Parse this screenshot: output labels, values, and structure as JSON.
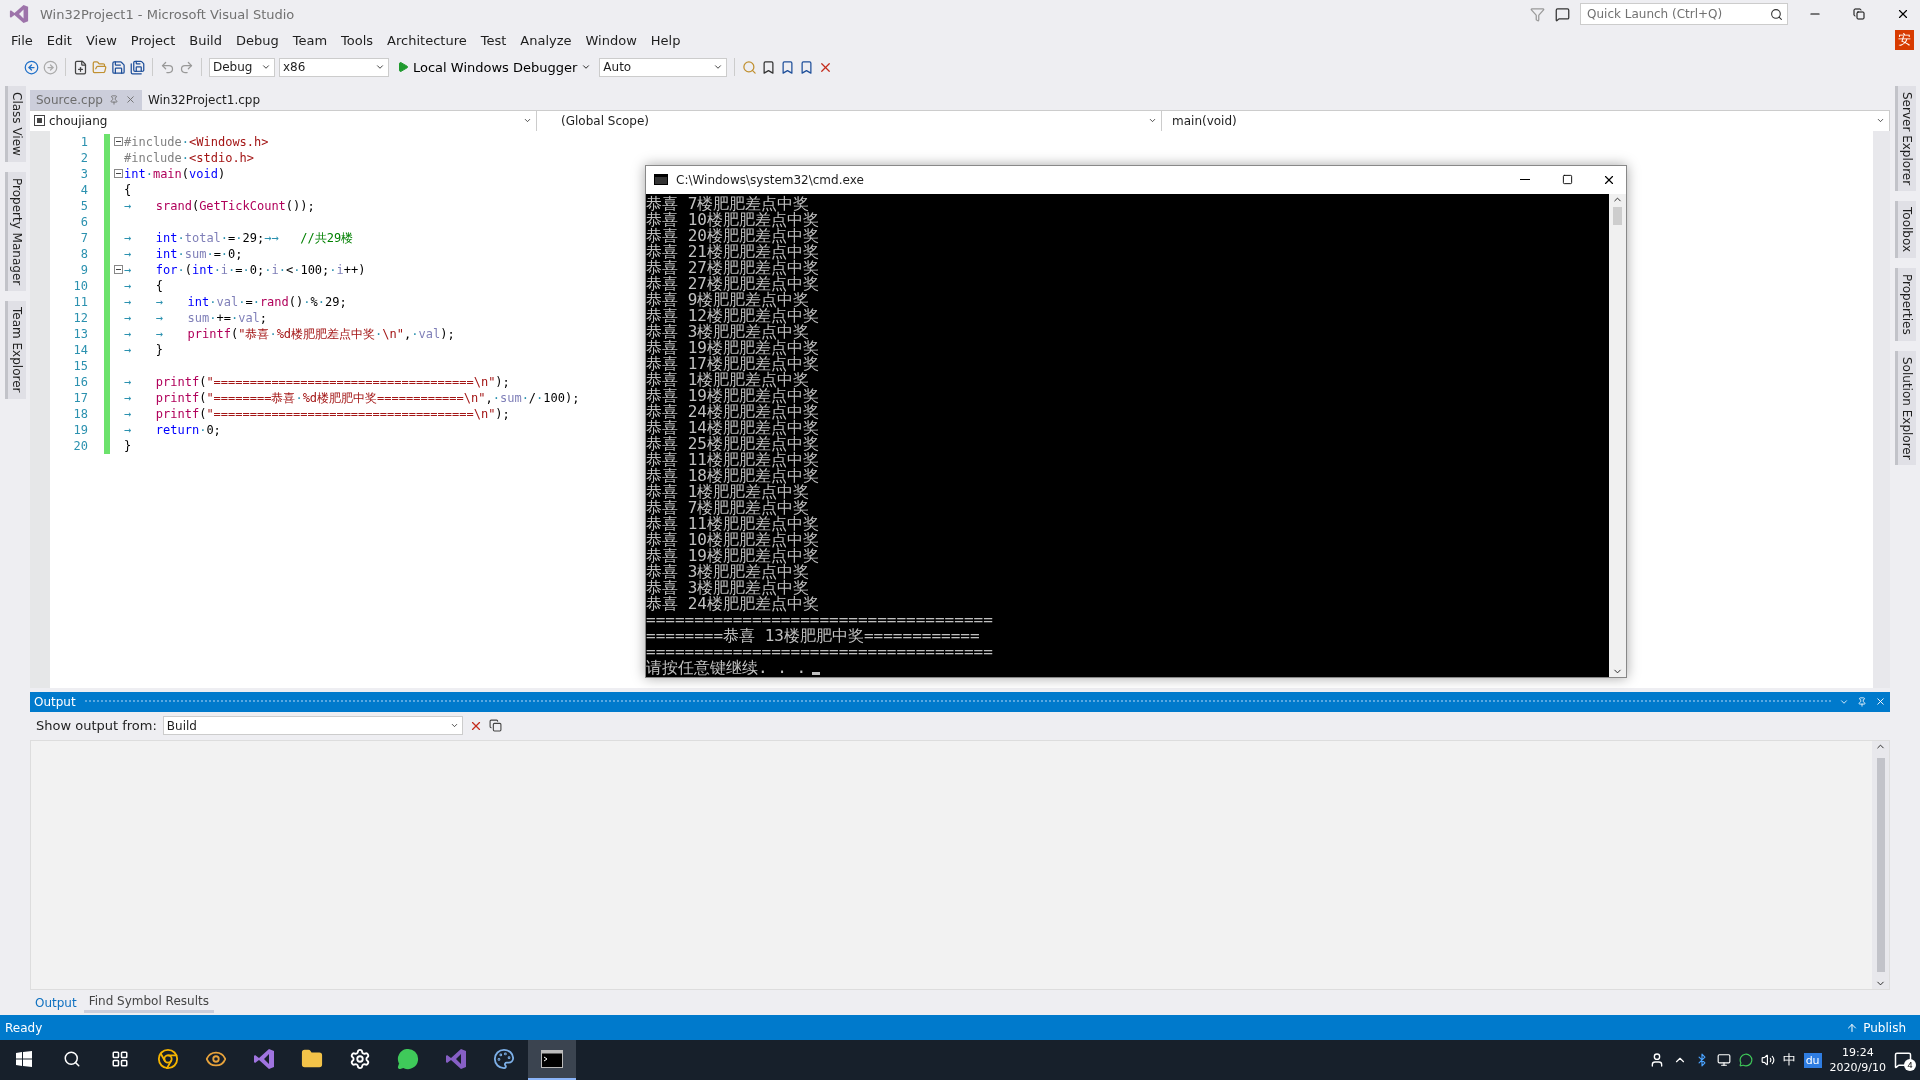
{
  "window": {
    "title": "Win32Project1 - Microsoft Visual Studio"
  },
  "quick_launch": {
    "placeholder": "Quick Launch (Ctrl+Q)"
  },
  "user_badge": "安",
  "menu": [
    "File",
    "Edit",
    "View",
    "Project",
    "Build",
    "Debug",
    "Team",
    "Tools",
    "Architecture",
    "Test",
    "Analyze",
    "Window",
    "Help"
  ],
  "toolbar": {
    "configuration": "Debug",
    "platform": "x86",
    "debugger": "Local Windows Debugger",
    "target": "Auto"
  },
  "left_tabs": [
    "Class View",
    "Property Manager",
    "Team Explorer"
  ],
  "right_tabs": [
    "Server Explorer",
    "Toolbox",
    "Properties",
    "Solution Explorer"
  ],
  "doc_tabs": [
    {
      "label": "Source.cpp",
      "selected": true
    },
    {
      "label": "Win32Project1.cpp",
      "selected": false
    }
  ],
  "nav_bar": {
    "project": "choujiang",
    "scope": "(Global Scope)",
    "member": "main(void)"
  },
  "editor": {
    "lines": [
      {
        "number": "1",
        "fold": true,
        "tokens": [
          {
            "kind": "pre",
            "text": "#include"
          },
          {
            "kind": "p",
            "text": "·"
          },
          {
            "kind": "str",
            "text": "<Windows.h>"
          }
        ]
      },
      {
        "number": "2",
        "fold": false,
        "tokens": [
          {
            "kind": "pre",
            "text": "#include"
          },
          {
            "kind": "p",
            "text": "·"
          },
          {
            "kind": "str",
            "text": "<stdio.h>"
          }
        ]
      },
      {
        "number": "3",
        "fold": true,
        "tokens": [
          {
            "kind": "kw",
            "text": "int"
          },
          {
            "kind": "p",
            "text": "·"
          },
          {
            "kind": "fn",
            "text": "main"
          },
          {
            "kind": "p",
            "text": "("
          },
          {
            "kind": "kw",
            "text": "void"
          },
          {
            "kind": "p",
            "text": ")"
          }
        ]
      },
      {
        "number": "4",
        "fold": false,
        "tokens": [
          {
            "kind": "p",
            "text": "{"
          }
        ]
      },
      {
        "number": "5",
        "fold": false,
        "tokens": [
          {
            "kind": "tab",
            "text": "→"
          },
          {
            "kind": "fn",
            "text": "srand"
          },
          {
            "kind": "p",
            "text": "("
          },
          {
            "kind": "fn",
            "text": "GetTickCount"
          },
          {
            "kind": "p",
            "text": "());"
          }
        ]
      },
      {
        "number": "6",
        "fold": false
      },
      {
        "number": "7",
        "fold": false,
        "tokens": [
          {
            "kind": "tab",
            "text": "→"
          },
          {
            "kind": "kw",
            "text": "int"
          },
          {
            "kind": "p",
            "text": "·"
          },
          {
            "kind": "var",
            "text": "total"
          },
          {
            "kind": "p",
            "text": "·=·29;"
          },
          {
            "kind": "ts",
            "text": "→→   "
          },
          {
            "kind": "cm",
            "text": "//共29楼"
          }
        ]
      },
      {
        "number": "8",
        "fold": false,
        "tokens": [
          {
            "kind": "tab",
            "text": "→"
          },
          {
            "kind": "kw",
            "text": "int"
          },
          {
            "kind": "p",
            "text": "·"
          },
          {
            "kind": "var",
            "text": "sum"
          },
          {
            "kind": "p",
            "text": "·=·0;"
          }
        ]
      },
      {
        "number": "9",
        "fold": true,
        "tokens": [
          {
            "kind": "tab",
            "text": "→"
          },
          {
            "kind": "kw",
            "text": "for"
          },
          {
            "kind": "p",
            "text": "·("
          },
          {
            "kind": "kw",
            "text": "int"
          },
          {
            "kind": "p",
            "text": "·"
          },
          {
            "kind": "var",
            "text": "i"
          },
          {
            "kind": "p",
            "text": "·=·0;·"
          },
          {
            "kind": "var",
            "text": "i"
          },
          {
            "kind": "p",
            "text": "·<·100;·"
          },
          {
            "kind": "var",
            "text": "i"
          },
          {
            "kind": "p",
            "text": "++)"
          }
        ]
      },
      {
        "number": "10",
        "fold": false,
        "tokens": [
          {
            "kind": "tab",
            "text": "→"
          },
          {
            "kind": "p",
            "text": "{"
          }
        ]
      },
      {
        "number": "11",
        "fold": false,
        "tokens": [
          {
            "kind": "tab",
            "text": "→"
          },
          {
            "kind": "tab",
            "text": "→"
          },
          {
            "kind": "kw",
            "text": "int"
          },
          {
            "kind": "p",
            "text": "·"
          },
          {
            "kind": "var",
            "text": "val"
          },
          {
            "kind": "p",
            "text": "·=·"
          },
          {
            "kind": "fn",
            "text": "rand"
          },
          {
            "kind": "p",
            "text": "()·%·29;"
          }
        ]
      },
      {
        "number": "12",
        "fold": false,
        "tokens": [
          {
            "kind": "tab",
            "text": "→"
          },
          {
            "kind": "tab",
            "text": "→"
          },
          {
            "kind": "var",
            "text": "sum"
          },
          {
            "kind": "p",
            "text": "·+=·"
          },
          {
            "kind": "var",
            "text": "val"
          },
          {
            "kind": "p",
            "text": ";"
          }
        ]
      },
      {
        "number": "13",
        "fold": false,
        "tokens": [
          {
            "kind": "tab",
            "text": "→"
          },
          {
            "kind": "tab",
            "text": "→"
          },
          {
            "kind": "fn",
            "text": "printf"
          },
          {
            "kind": "p",
            "text": "("
          },
          {
            "kind": "str",
            "text": "\"恭喜·%d楼肥肥差点中奖·\\n\""
          },
          {
            "kind": "p",
            "text": ",·"
          },
          {
            "kind": "var",
            "text": "val"
          },
          {
            "kind": "p",
            "text": ");"
          }
        ]
      },
      {
        "number": "14",
        "fold": false,
        "tokens": [
          {
            "kind": "tab",
            "text": "→"
          },
          {
            "kind": "p",
            "text": "}"
          }
        ]
      },
      {
        "number": "15",
        "fold": false
      },
      {
        "number": "16",
        "fold": false,
        "tokens": [
          {
            "kind": "tab",
            "text": "→"
          },
          {
            "kind": "fn",
            "text": "printf"
          },
          {
            "kind": "p",
            "text": "("
          },
          {
            "kind": "str",
            "text": "\"====================================\\n\""
          },
          {
            "kind": "p",
            "text": ");"
          }
        ]
      },
      {
        "number": "17",
        "fold": false,
        "tokens": [
          {
            "kind": "tab",
            "text": "→"
          },
          {
            "kind": "fn",
            "text": "printf"
          },
          {
            "kind": "p",
            "text": "("
          },
          {
            "kind": "str",
            "text": "\"========恭喜·%d楼肥肥中奖============\\n\""
          },
          {
            "kind": "p",
            "text": ",·"
          },
          {
            "kind": "var",
            "text": "sum"
          },
          {
            "kind": "p",
            "text": "·/·100);"
          }
        ]
      },
      {
        "number": "18",
        "fold": false,
        "tokens": [
          {
            "kind": "tab",
            "text": "→"
          },
          {
            "kind": "fn",
            "text": "printf"
          },
          {
            "kind": "p",
            "text": "("
          },
          {
            "kind": "str",
            "text": "\"====================================\\n\""
          },
          {
            "kind": "p",
            "text": ");"
          }
        ]
      },
      {
        "number": "19",
        "fold": false,
        "tokens": [
          {
            "kind": "tab",
            "text": "→"
          },
          {
            "kind": "kw",
            "text": "return"
          },
          {
            "kind": "p",
            "text": "·0;"
          }
        ]
      },
      {
        "number": "20",
        "fold": false,
        "tokens": [
          {
            "kind": "p",
            "text": "}"
          }
        ]
      }
    ]
  },
  "console": {
    "title": "C:\\Windows\\system32\\cmd.exe",
    "lines": [
      "恭喜 7楼肥肥差点中奖",
      "恭喜 10楼肥肥差点中奖",
      "恭喜 20楼肥肥差点中奖",
      "恭喜 21楼肥肥差点中奖",
      "恭喜 27楼肥肥差点中奖",
      "恭喜 27楼肥肥差点中奖",
      "恭喜 9楼肥肥差点中奖",
      "恭喜 12楼肥肥差点中奖",
      "恭喜 3楼肥肥差点中奖",
      "恭喜 19楼肥肥差点中奖",
      "恭喜 17楼肥肥差点中奖",
      "恭喜 1楼肥肥差点中奖",
      "恭喜 19楼肥肥差点中奖",
      "恭喜 24楼肥肥差点中奖",
      "恭喜 14楼肥肥差点中奖",
      "恭喜 25楼肥肥差点中奖",
      "恭喜 11楼肥肥差点中奖",
      "恭喜 18楼肥肥差点中奖",
      "恭喜 1楼肥肥差点中奖",
      "恭喜 7楼肥肥差点中奖",
      "恭喜 11楼肥肥差点中奖",
      "恭喜 10楼肥肥差点中奖",
      "恭喜 19楼肥肥差点中奖",
      "恭喜 3楼肥肥差点中奖",
      "恭喜 3楼肥肥差点中奖",
      "恭喜 24楼肥肥差点中奖",
      "====================================",
      "========恭喜 13楼肥肥中奖============",
      "====================================",
      "请按任意键继续. . ."
    ]
  },
  "output": {
    "title": "Output",
    "source_label": "Show output from:",
    "source": "Build"
  },
  "bottom_tabs": [
    {
      "label": "Output",
      "selected": true
    },
    {
      "label": "Find Symbol Results",
      "selected": false
    }
  ],
  "status_bar": {
    "text": "Ready",
    "publish": "Publish"
  },
  "taskbar": {
    "apps": [
      {
        "kind": "start",
        "active": false
      },
      {
        "kind": "search",
        "active": false
      },
      {
        "kind": "taskview",
        "active": false
      },
      {
        "kind": "browser",
        "active": false
      },
      {
        "kind": "eye",
        "active": false
      },
      {
        "kind": "studio-purple",
        "active": false
      },
      {
        "kind": "folder",
        "active": false
      },
      {
        "kind": "gear",
        "active": false
      },
      {
        "kind": "chat",
        "active": false
      },
      {
        "kind": "studio",
        "active": false
      },
      {
        "kind": "palette",
        "active": false
      },
      {
        "kind": "console",
        "active": true
      }
    ],
    "ime": "中",
    "tray_app": "du",
    "time": "19:24",
    "date": "2020/9/10",
    "notifications": "4"
  }
}
